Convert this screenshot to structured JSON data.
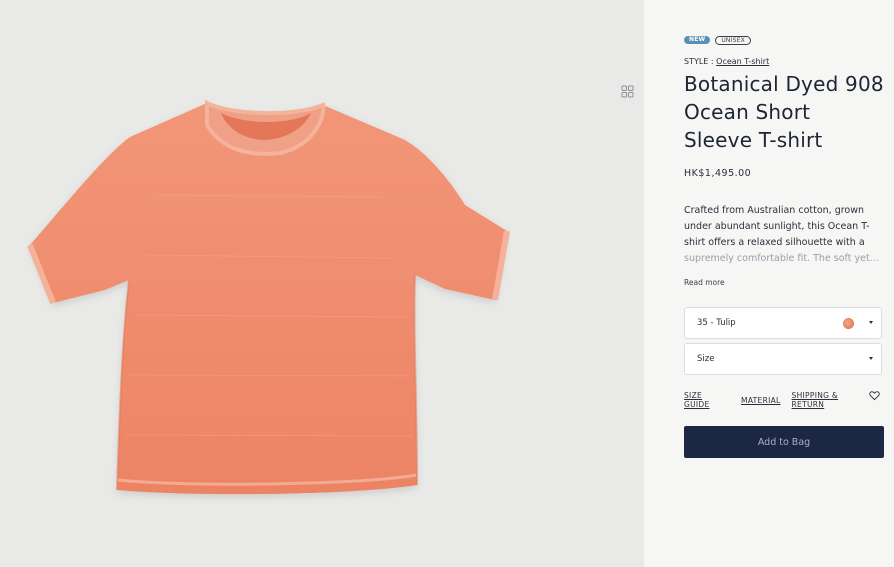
{
  "product": {
    "badges": {
      "new": "NEW",
      "unisex": "UNISEX"
    },
    "style_prefix": "STYLE :",
    "style_link": "Ocean T-shirt",
    "title": "Botanical Dyed 908 Ocean Short Sleeve T-shirt",
    "price": "HK$1,495.00",
    "description_visible": "Crafted from Australian cotton, grown under abundant sunlight, this Ocean T-shirt offers a relaxed silhouette with a",
    "description_faded": "supremely comfortable fit. The soft yet...",
    "read_more": "Read more",
    "color_select": {
      "value": "35 - Tulip",
      "swatch_color": "#e8845f"
    },
    "size_select": {
      "value": "Size"
    },
    "links": {
      "size_guide": "SIZE GUIDE",
      "material": "MATERIAL",
      "shipping": "SHIPPING & RETURN"
    },
    "add_to_bag": "Add to Bag"
  },
  "gallery": {
    "background": "#e9eae8",
    "shirt_color": "#ef8a6a",
    "view_toggle_icon": "grid-view-icon"
  },
  "icons": {
    "wishlist": "heart-icon"
  },
  "colors": {
    "accent": "#1c2744",
    "badge_new": "#5a8fb5"
  }
}
